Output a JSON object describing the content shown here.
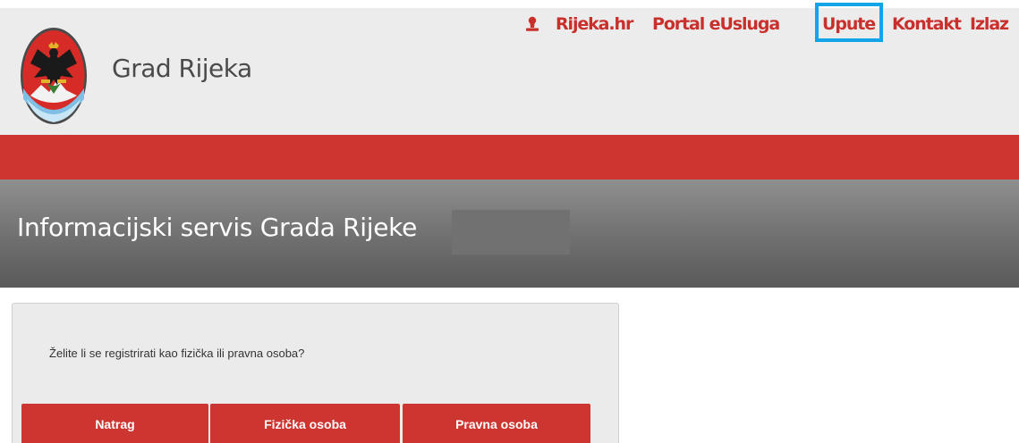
{
  "header": {
    "title": "Grad Rijeka",
    "logo_icon": "rijeka-coat-of-arms",
    "nav": {
      "user_icon": "user-icon",
      "links": [
        "Rijeka.hr",
        "Portal eUsluga",
        "Upute",
        "Kontakt",
        "Izlaz"
      ]
    }
  },
  "banner": {
    "title": "Informacijski servis Grada Rijeke"
  },
  "panel": {
    "question": "Želite li se registrirati kao fizička ili pravna osoba?",
    "buttons": {
      "back": "Natrag",
      "individual": "Fizička osoba",
      "legal": "Pravna osoba"
    }
  },
  "colors": {
    "brand_red": "#cd3530",
    "nav_link": "#c9302c",
    "highlight": "#11a4e8",
    "header_bg": "#ececec"
  }
}
